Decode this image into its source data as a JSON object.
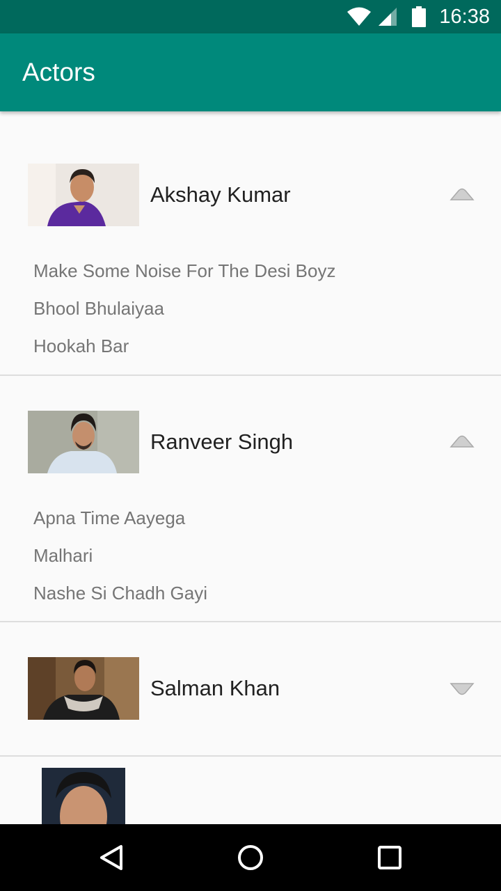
{
  "status_bar": {
    "time": "16:38",
    "icons": [
      "wifi-icon",
      "signal-icon",
      "battery-icon"
    ]
  },
  "app_bar": {
    "title": "Actors"
  },
  "actors": [
    {
      "name": "Akshay Kumar",
      "expanded": true,
      "songs": [
        "Make Some Noise For The Desi Boyz",
        "Bhool Bhulaiyaa",
        "Hookah Bar"
      ]
    },
    {
      "name": "Ranveer Singh",
      "expanded": true,
      "songs": [
        "Apna Time Aayega",
        "Malhari",
        "Nashe Si Chadh Gayi"
      ]
    },
    {
      "name": "Salman Khan",
      "expanded": false,
      "songs": []
    }
  ],
  "nav_bar": {
    "buttons": [
      "back-icon",
      "home-icon",
      "recents-icon"
    ]
  },
  "colors": {
    "status_bar": "#00695c",
    "app_bar": "#00897b",
    "background": "#fafafa",
    "song_text": "#757575",
    "divider": "#dddddd"
  }
}
